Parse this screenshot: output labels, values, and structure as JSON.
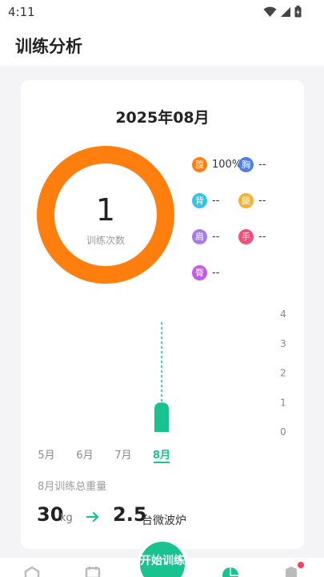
{
  "status_bar": {
    "time": "4:11"
  },
  "header": {
    "title": "训练分析"
  },
  "card": {
    "month_title": "2025年08月",
    "donut": {
      "count": "1",
      "label": "训练次数",
      "color": "#ff7f0e",
      "fill_fraction": 1.0
    },
    "legend": [
      {
        "glyph": "腹",
        "value": "100%",
        "color": "#ff7f0e"
      },
      {
        "glyph": "胸",
        "value": "--",
        "color": "#4f7fe6"
      },
      {
        "glyph": "背",
        "value": "--",
        "color": "#35c4e8"
      },
      {
        "glyph": "腿",
        "value": "--",
        "color": "#f2b233"
      },
      {
        "glyph": "肩",
        "value": "--",
        "color": "#a67be6"
      },
      {
        "glyph": "手",
        "value": "--",
        "color": "#ef4f7a"
      },
      {
        "glyph": "臀",
        "value": "--",
        "color": "#c45ae6"
      }
    ],
    "summary": {
      "label": "8月训练总重量",
      "weight_value": "30",
      "weight_unit": "kg",
      "equiv_value": "2.5",
      "equiv_label": "台微波炉"
    }
  },
  "chart_data": {
    "type": "bar",
    "categories": [
      "5月",
      "6月",
      "7月",
      "8月"
    ],
    "values": [
      0,
      0,
      0,
      1
    ],
    "selected_category": "8月",
    "y_ticks": [
      "0",
      "1",
      "2",
      "3",
      "4"
    ],
    "ylim": [
      0,
      4
    ],
    "bar_color": "#19c28e",
    "axis_position": "right"
  },
  "bottom_nav": {
    "fab_label": "开始训练"
  }
}
